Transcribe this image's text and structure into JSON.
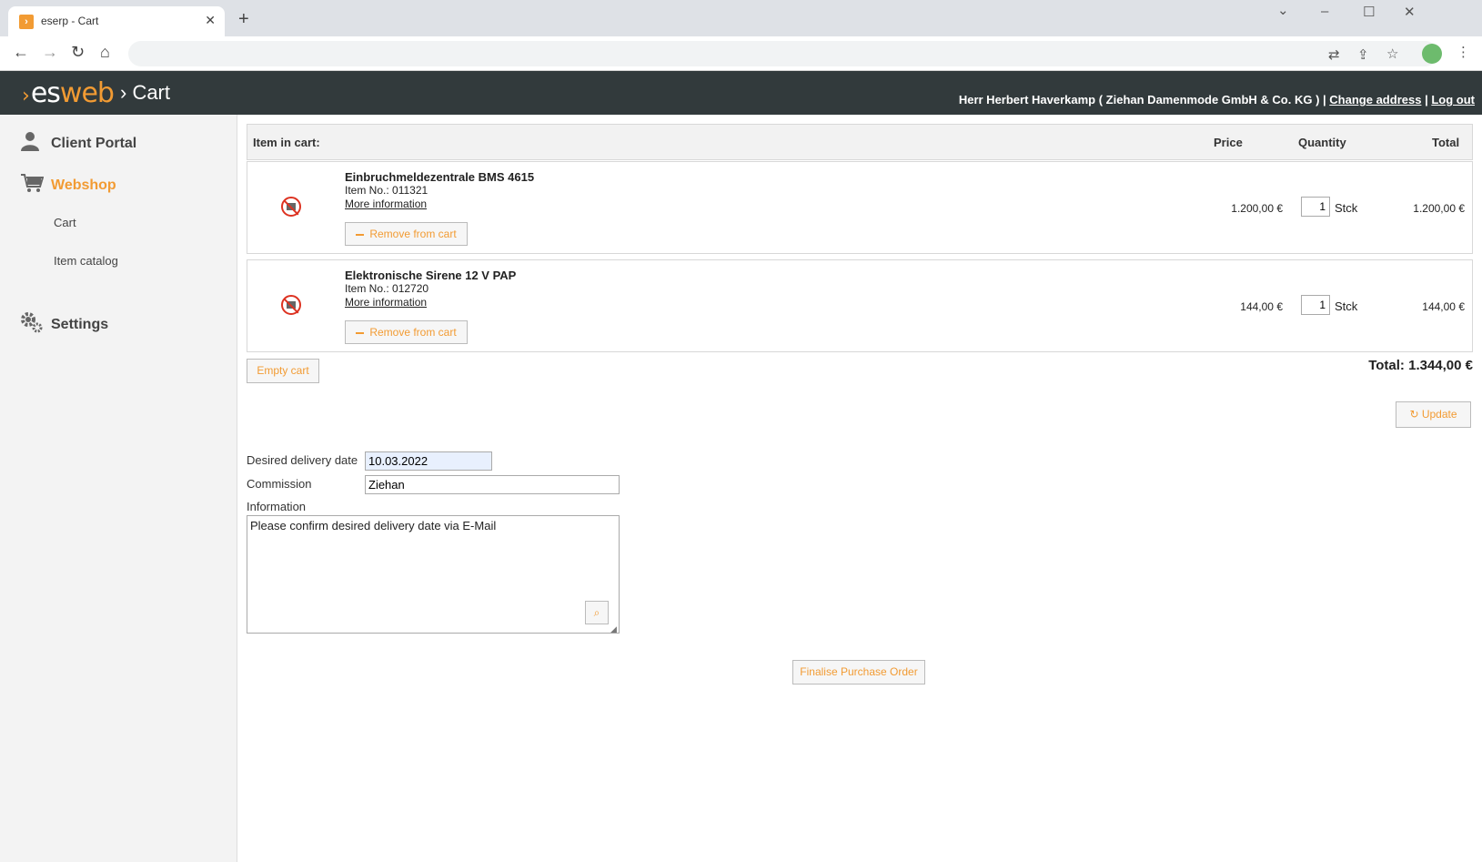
{
  "browser": {
    "tab_title": "eserp - Cart",
    "favicon_glyph": "›",
    "tab_close": "✕",
    "new_tab": "+",
    "controls": {
      "minimize": "–",
      "maximize": "☐",
      "close": "✕",
      "tab_search": "⌄"
    },
    "nav": {
      "back": "←",
      "forward": "→",
      "reload": "↻",
      "home": "⌂"
    },
    "toolbar_icons": {
      "translate": "⇄",
      "share": "⇪",
      "bookmark": "☆",
      "menu": "⋮"
    }
  },
  "header": {
    "logo_arrow": "›",
    "logo_es": "es",
    "logo_web": "web",
    "crumb": "› Cart",
    "user_text": "Herr Herbert Haverkamp ( Ziehan Damenmode GmbH & Co. KG ) |",
    "change_address": "Change address",
    "separator": "|",
    "logout": "Log out",
    "accent_color": "#f29b33"
  },
  "sidebar": {
    "client_portal": "Client Portal",
    "webshop": "Webshop",
    "cart": "Cart",
    "item_catalog": "Item catalog",
    "settings": "Settings"
  },
  "cart": {
    "head_item": "Item in cart:",
    "head_price": "Price",
    "head_quantity": "Quantity",
    "head_total": "Total",
    "items": [
      {
        "name": "Einbruchmeldezentrale BMS 4615",
        "item_no": "Item No.: 011321",
        "more": "More information",
        "remove": "Remove from cart",
        "price": "1.200,00 €",
        "qty": "1",
        "unit": "Stck",
        "total": "1.200,00 €"
      },
      {
        "name": "Elektronische Sirene 12 V PAP",
        "item_no": "Item No.: 012720",
        "more": "More information",
        "remove": "Remove from cart",
        "price": "144,00 €",
        "qty": "1",
        "unit": "Stck",
        "total": "144,00 €"
      }
    ],
    "empty_cart": "Empty cart",
    "grand_total": "Total: 1.344,00 €",
    "update": "Update",
    "update_icon": "↻"
  },
  "form": {
    "date_label": "Desired delivery date",
    "date_value": "10.03.2022",
    "commission_label": "Commission",
    "commission_value": "Ziehan",
    "info_label": "Information",
    "info_value": "Please confirm desired delivery date via E-Mail",
    "zoom_icon": "⌕",
    "finalise": "Finalise Purchase Order"
  }
}
